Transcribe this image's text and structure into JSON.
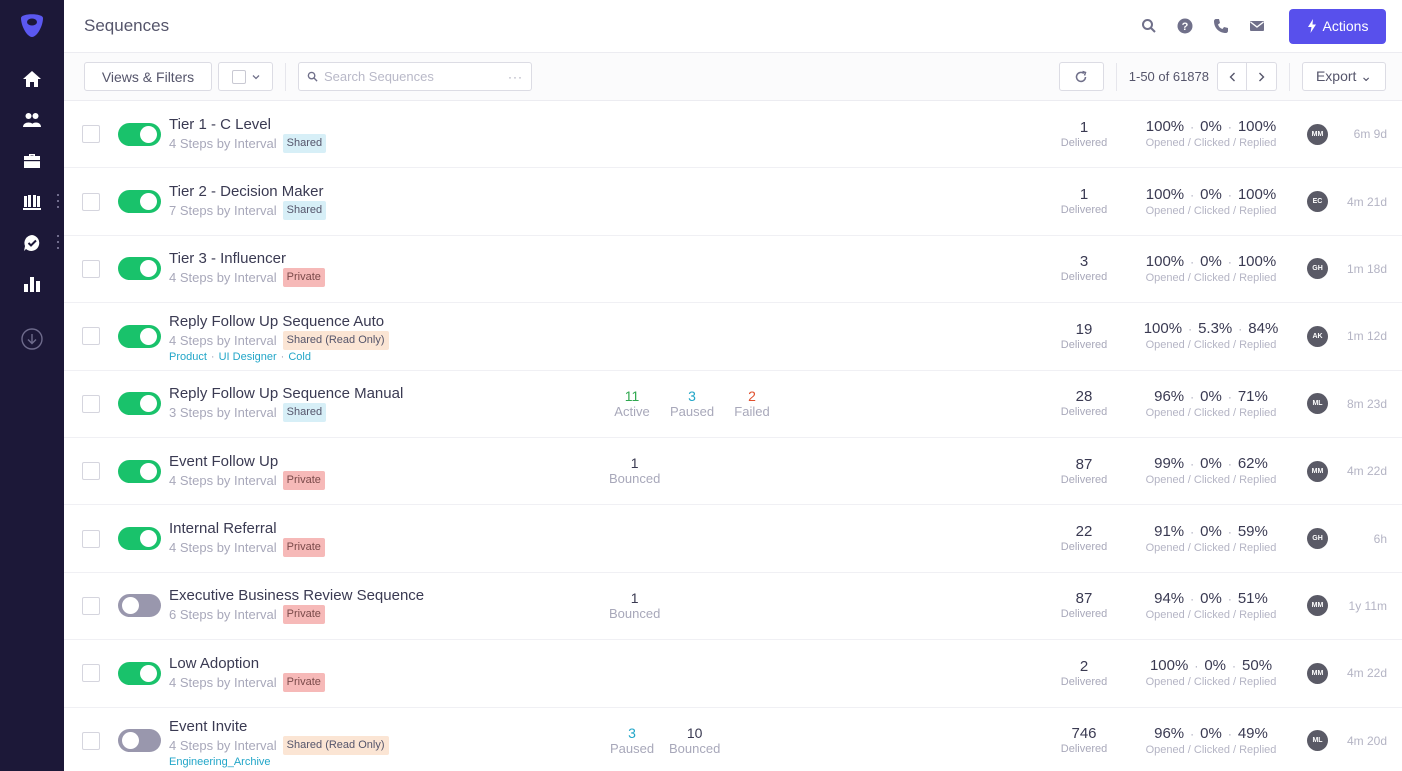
{
  "header": {
    "title": "Sequences",
    "actions_label": "Actions"
  },
  "toolbar": {
    "views_filters_label": "Views & Filters",
    "search_placeholder": "Search Sequences",
    "more_label": "···",
    "pager_text": "1-50 of 61878",
    "export_label": "Export ⌄"
  },
  "sidebar": {
    "items": [
      {
        "icon": "home-icon"
      },
      {
        "icon": "people-icon"
      },
      {
        "icon": "briefcase-icon"
      },
      {
        "icon": "library-icon"
      },
      {
        "icon": "tasks-icon"
      },
      {
        "icon": "reports-icon"
      },
      {
        "icon": "download-icon"
      }
    ]
  },
  "colors": {
    "brand": "#5850ec",
    "sidebar_bg": "#1c1838",
    "toggle_on": "#19c26b",
    "toggle_off": "#9997ad"
  },
  "rows": [
    {
      "name": "Tier 1 - C Level",
      "steps": "4 Steps by Interval",
      "badge": "Shared",
      "badge_type": "shared",
      "enabled": true,
      "tags": [],
      "counts": [],
      "delivered": "1",
      "delivered_label": "Delivered",
      "opened": "100%",
      "clicked": "0%",
      "replied": "100%",
      "rates_label": "Opened / Clicked / Replied",
      "owner": "MM",
      "age": "6m 9d"
    },
    {
      "name": "Tier 2 - Decision Maker",
      "steps": "7 Steps by Interval",
      "badge": "Shared",
      "badge_type": "shared",
      "enabled": true,
      "tags": [],
      "counts": [],
      "delivered": "1",
      "delivered_label": "Delivered",
      "opened": "100%",
      "clicked": "0%",
      "replied": "100%",
      "rates_label": "Opened / Clicked / Replied",
      "owner": "EC",
      "age": "4m 21d"
    },
    {
      "name": "Tier 3 - Influencer",
      "steps": "4 Steps by Interval",
      "badge": "Private",
      "badge_type": "private",
      "enabled": true,
      "tags": [],
      "counts": [],
      "delivered": "3",
      "delivered_label": "Delivered",
      "opened": "100%",
      "clicked": "0%",
      "replied": "100%",
      "rates_label": "Opened / Clicked / Replied",
      "owner": "GH",
      "age": "1m 18d"
    },
    {
      "name": "Reply Follow Up Sequence Auto",
      "steps": "4 Steps by Interval",
      "badge": "Shared (Read Only)",
      "badge_type": "readonly",
      "enabled": true,
      "tags": [
        "Product",
        "UI Designer",
        "Cold"
      ],
      "counts": [],
      "delivered": "19",
      "delivered_label": "Delivered",
      "opened": "100%",
      "clicked": "5.3%",
      "replied": "84%",
      "rates_label": "Opened / Clicked / Replied",
      "owner": "AK",
      "age": "1m 12d"
    },
    {
      "name": "Reply Follow Up Sequence Manual",
      "steps": "3 Steps by Interval",
      "badge": "Shared",
      "badge_type": "shared",
      "enabled": true,
      "tags": [],
      "counts": [
        {
          "n": "11",
          "label": "Active",
          "type": "active"
        },
        {
          "n": "3",
          "label": "Paused",
          "type": "paused"
        },
        {
          "n": "2",
          "label": "Failed",
          "type": "failed"
        }
      ],
      "delivered": "28",
      "delivered_label": "Delivered",
      "opened": "96%",
      "clicked": "0%",
      "replied": "71%",
      "rates_label": "Opened / Clicked / Replied",
      "owner": "ML",
      "age": "8m 23d"
    },
    {
      "name": "Event Follow Up",
      "steps": "4 Steps by Interval",
      "badge": "Private",
      "badge_type": "private",
      "enabled": true,
      "tags": [],
      "counts": [
        {
          "n": "1",
          "label": "Bounced",
          "type": "bounced"
        }
      ],
      "delivered": "87",
      "delivered_label": "Delivered",
      "opened": "99%",
      "clicked": "0%",
      "replied": "62%",
      "rates_label": "Opened / Clicked / Replied",
      "owner": "MM",
      "age": "4m 22d"
    },
    {
      "name": "Internal Referral",
      "steps": "4 Steps by Interval",
      "badge": "Private",
      "badge_type": "private",
      "enabled": true,
      "tags": [],
      "counts": [],
      "delivered": "22",
      "delivered_label": "Delivered",
      "opened": "91%",
      "clicked": "0%",
      "replied": "59%",
      "rates_label": "Opened / Clicked / Replied",
      "owner": "GH",
      "age": "6h"
    },
    {
      "name": "Executive Business Review Sequence",
      "steps": "6 Steps by Interval",
      "badge": "Private",
      "badge_type": "private",
      "enabled": false,
      "tags": [],
      "counts": [
        {
          "n": "1",
          "label": "Bounced",
          "type": "bounced"
        }
      ],
      "delivered": "87",
      "delivered_label": "Delivered",
      "opened": "94%",
      "clicked": "0%",
      "replied": "51%",
      "rates_label": "Opened / Clicked / Replied",
      "owner": "MM",
      "age": "1y 11m"
    },
    {
      "name": "Low Adoption",
      "steps": "4 Steps by Interval",
      "badge": "Private",
      "badge_type": "private",
      "enabled": true,
      "tags": [],
      "counts": [],
      "delivered": "2",
      "delivered_label": "Delivered",
      "opened": "100%",
      "clicked": "0%",
      "replied": "50%",
      "rates_label": "Opened / Clicked / Replied",
      "owner": "MM",
      "age": "4m 22d"
    },
    {
      "name": "Event Invite",
      "steps": "4 Steps by Interval",
      "badge": "Shared (Read Only)",
      "badge_type": "readonly",
      "enabled": false,
      "tags": [
        "Engineering_Archive"
      ],
      "counts": [
        {
          "n": "3",
          "label": "Paused",
          "type": "paused"
        },
        {
          "n": "10",
          "label": "Bounced",
          "type": "bounced"
        }
      ],
      "delivered": "746",
      "delivered_label": "Delivered",
      "opened": "96%",
      "clicked": "0%",
      "replied": "49%",
      "rates_label": "Opened / Clicked / Replied",
      "owner": "ML",
      "age": "4m 20d"
    }
  ]
}
